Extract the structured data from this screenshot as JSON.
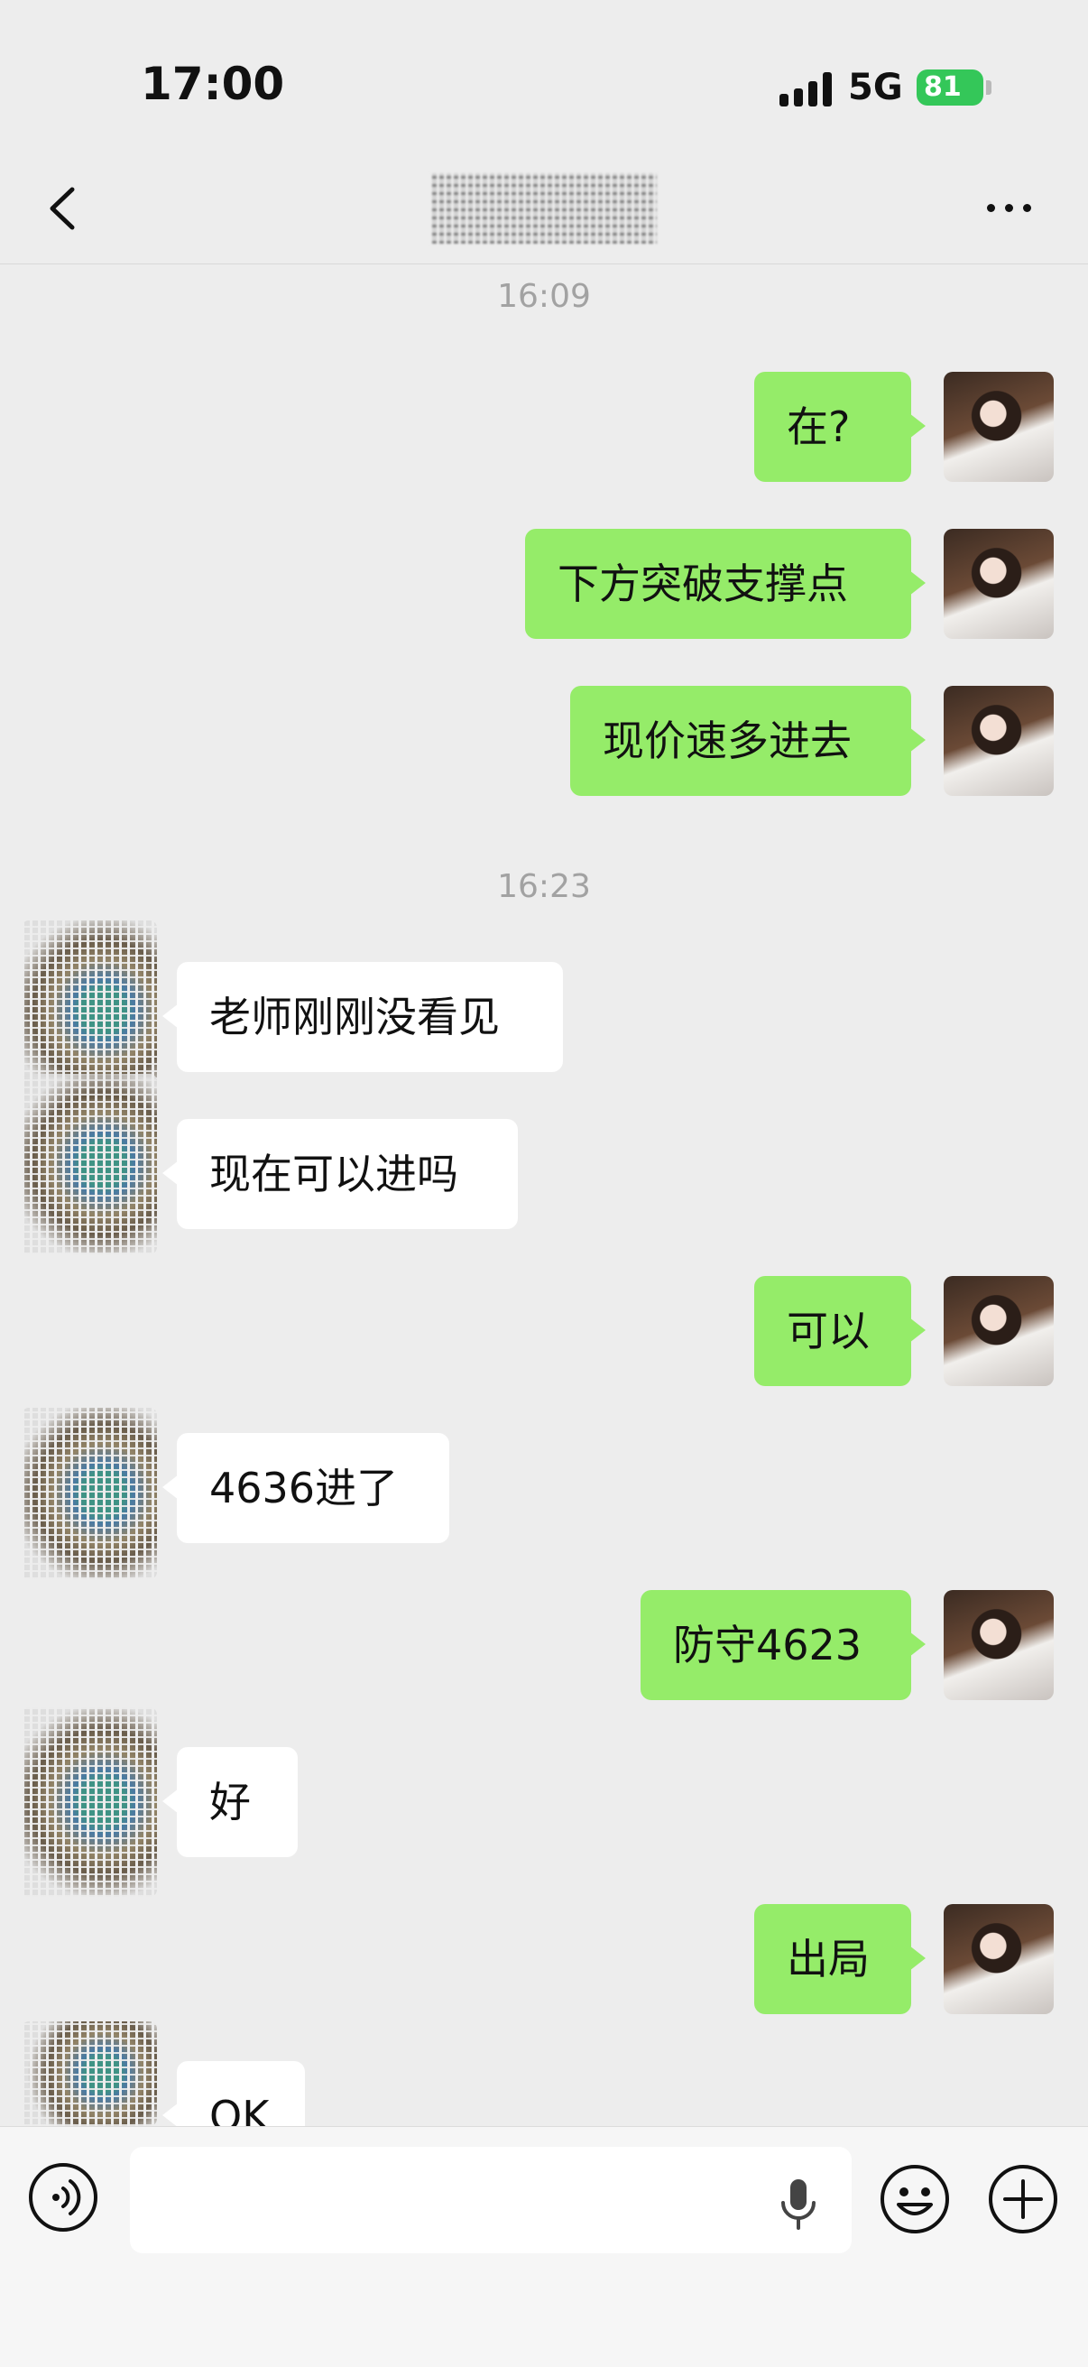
{
  "status_bar": {
    "time": "17:00",
    "network": "5G",
    "battery": "81"
  },
  "nav": {
    "back_icon": "chevron-left-icon",
    "more_icon": "more-dots-icon"
  },
  "timestamps": [
    "16:09",
    "16:23"
  ],
  "messages": [
    {
      "from": "me",
      "text": "在?"
    },
    {
      "from": "me",
      "text": "下方突破支撑点"
    },
    {
      "from": "me",
      "text": "现价速多进去"
    },
    {
      "from": "other",
      "text": "老师刚刚没看见"
    },
    {
      "from": "other",
      "text": "现在可以进吗"
    },
    {
      "from": "me",
      "text": "可以"
    },
    {
      "from": "other",
      "text": "4636进了"
    },
    {
      "from": "me",
      "text": "防守4623"
    },
    {
      "from": "other",
      "text": "好"
    },
    {
      "from": "me",
      "text": "出局"
    },
    {
      "from": "other",
      "text": "OK"
    }
  ],
  "input_bar": {
    "voice_icon": "voice-icon",
    "mic_icon": "mic-icon",
    "emoji_icon": "emoji-icon",
    "plus_icon": "plus-icon",
    "text_value": ""
  },
  "colors": {
    "outgoing_bubble": "#95ec69",
    "incoming_bubble": "#ffffff",
    "background": "#ededed"
  }
}
